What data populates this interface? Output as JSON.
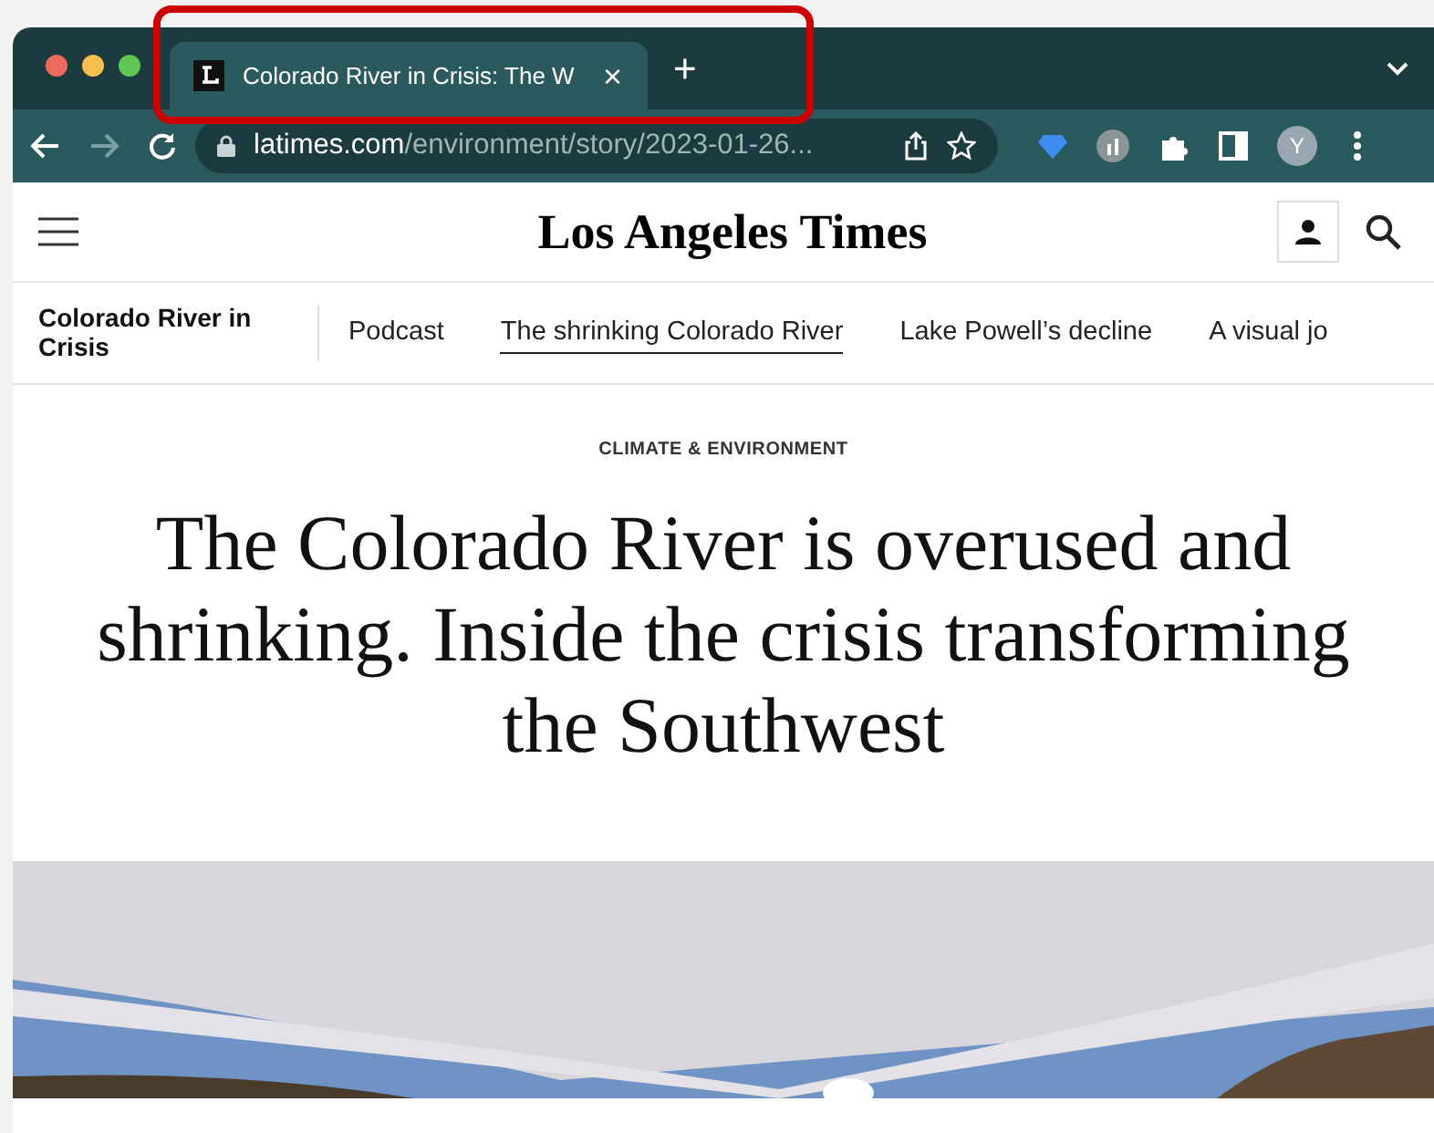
{
  "browser": {
    "tabs": [
      {
        "title": "Colorado River in Crisis: The W",
        "selected": true
      }
    ],
    "new_tab": "+",
    "close": "×",
    "address": {
      "domain": "latimes.com",
      "path": "/environment/story/2023-01-26..."
    },
    "profile": "Y",
    "highlight": true
  },
  "site": {
    "logo": "Los Angeles Times",
    "section_title": "Colorado River in Crisis",
    "nav": [
      {
        "label": "Podcast",
        "selected": false
      },
      {
        "label": "The shrinking Colorado River",
        "selected": true
      },
      {
        "label": "Lake Powell’s decline",
        "selected": false
      },
      {
        "label": "A visual jo",
        "selected": false
      }
    ]
  },
  "article": {
    "kicker": "CLIMATE & ENVIRONMENT",
    "headline": "The Colorado River is overused and shrinking. Inside the crisis transforming the Southwest"
  }
}
